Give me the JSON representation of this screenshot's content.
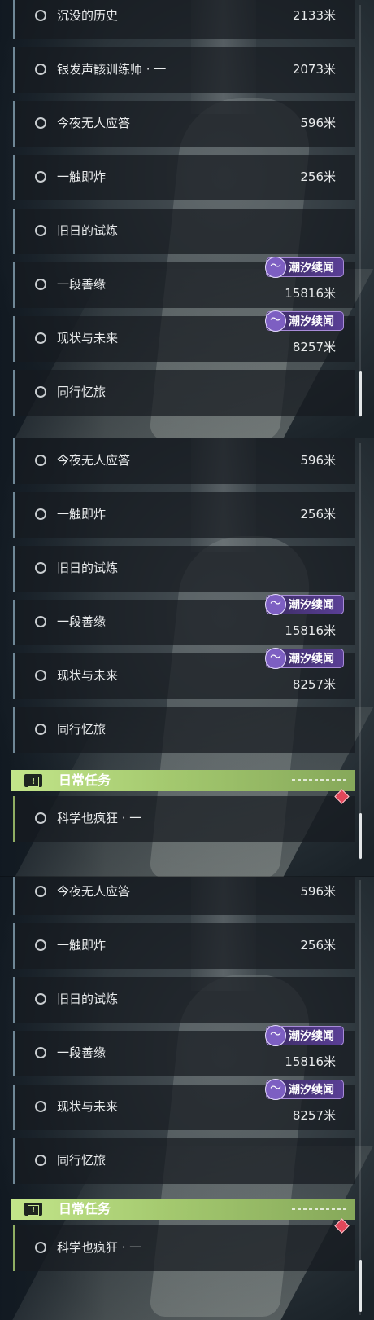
{
  "reward_tag_label": "潮汐续闻",
  "panel1": {
    "quests": [
      {
        "name": "沉没的历史",
        "distance": "2133米"
      },
      {
        "name": "银发声骸训练师 · 一",
        "distance": "2073米"
      },
      {
        "name": "今夜无人应答",
        "distance": "596米"
      },
      {
        "name": "一触即炸",
        "distance": "256米"
      },
      {
        "name": "旧日的试炼",
        "distance": ""
      },
      {
        "name": "一段善缘",
        "distance": "15816米",
        "tag": "潮汐续闻"
      },
      {
        "name": "现状与未来",
        "distance": "8257米",
        "tag": "潮汐续闻"
      },
      {
        "name": "同行忆旅",
        "distance": ""
      }
    ]
  },
  "panel2": {
    "quests": [
      {
        "name": "今夜无人应答",
        "distance": "596米"
      },
      {
        "name": "一触即炸",
        "distance": "256米"
      },
      {
        "name": "旧日的试炼",
        "distance": ""
      },
      {
        "name": "一段善缘",
        "distance": "15816米",
        "tag": "潮汐续闻"
      },
      {
        "name": "现状与未来",
        "distance": "8257米",
        "tag": "潮汐续闻"
      },
      {
        "name": "同行忆旅",
        "distance": ""
      }
    ],
    "section_title": "日常任务",
    "daily": [
      {
        "name": "科学也疯狂 · 一"
      }
    ]
  },
  "panel3": {
    "quests": [
      {
        "name": "今夜无人应答",
        "distance": "596米"
      },
      {
        "name": "一触即炸",
        "distance": "256米"
      },
      {
        "name": "旧日的试炼",
        "distance": ""
      },
      {
        "name": "一段善缘",
        "distance": "15816米",
        "tag": "潮汐续闻"
      },
      {
        "name": "现状与未来",
        "distance": "8257米",
        "tag": "潮汐续闻"
      },
      {
        "name": "同行忆旅",
        "distance": ""
      }
    ],
    "section_title": "日常任务",
    "daily": [
      {
        "name": "科学也疯狂 · 一"
      }
    ]
  },
  "colors": {
    "row_accent": "#6f8796",
    "daily_accent": "#8fae63",
    "tag_purple": "#5a3f96",
    "section_green": "#a4c96f",
    "alert_red": "#e2475a"
  },
  "icons": {
    "status": "circle-ring-icon",
    "tag_emblem": "wave-crest-icon",
    "section": "exclamation-box-icon",
    "alert": "red-diamond-icon"
  }
}
